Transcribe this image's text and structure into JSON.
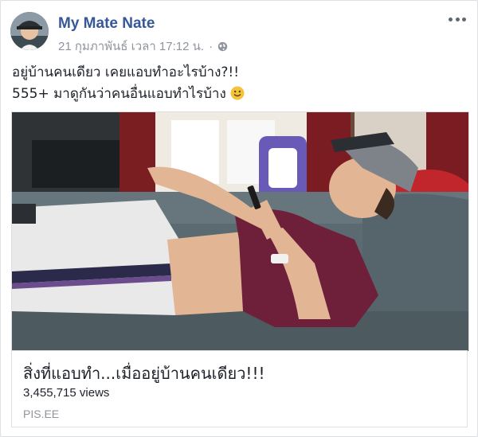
{
  "post": {
    "author": "My Mate Nate",
    "timestamp": "21 กุมภาพันธ์ เวลา 17:12 น.",
    "separator": "·",
    "privacy_icon": "globe-icon",
    "menu_icon": "more-options-icon",
    "text_line1": "อยู่บ้านคนเดียว เคยแอบทำอะไรบ้าง?!!",
    "text_line2": "555+ มาดูกันว่าคนอื่นแอบทำไรบ้าง",
    "emoji": "smiley-icon"
  },
  "link_preview": {
    "title": "สิ่งที่แอบทำ...เมื่ออยู่บ้านคนเดียว!!!",
    "views": "3,455,715 views",
    "domain": "PIS.EE"
  },
  "colors": {
    "author": "#365899",
    "meta": "#90949c",
    "text": "#1d2129",
    "shirt": "#6e1f3a",
    "couch": "#5b6a70"
  }
}
